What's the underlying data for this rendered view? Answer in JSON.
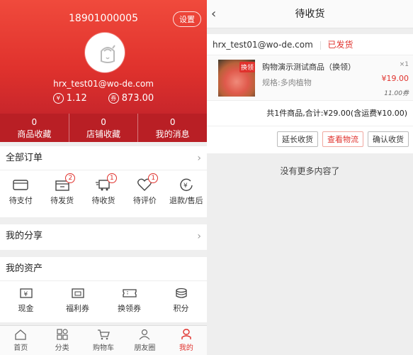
{
  "profile": {
    "phone": "18901000005",
    "settings_label": "设置",
    "email": "hrx_test01@wo-de.com",
    "cash_symbol": "¥",
    "cash_balance": "1.12",
    "coupon_symbol": "券",
    "coupon_balance": "873.00"
  },
  "stats": [
    {
      "count": "0",
      "label": "商品收藏"
    },
    {
      "count": "0",
      "label": "店铺收藏"
    },
    {
      "count": "0",
      "label": "我的消息"
    }
  ],
  "orders_section": {
    "title": "全部订单",
    "chevron": "›",
    "items": [
      {
        "label": "待支付",
        "icon": "wallet-icon",
        "badge": ""
      },
      {
        "label": "待发货",
        "icon": "box-icon",
        "badge": "2"
      },
      {
        "label": "待收货",
        "icon": "truck-icon",
        "badge": "1"
      },
      {
        "label": "待评价",
        "icon": "heart-icon",
        "badge": "1"
      },
      {
        "label": "退款/售后",
        "icon": "refund-icon",
        "badge": ""
      }
    ]
  },
  "share_section": {
    "title": "我的分享",
    "chevron": "›"
  },
  "assets_section": {
    "title": "我的资产",
    "items": [
      {
        "label": "现金",
        "icon": "cash-icon"
      },
      {
        "label": "福利券",
        "icon": "voucher-icon"
      },
      {
        "label": "换领券",
        "icon": "ticket-icon"
      },
      {
        "label": "积分",
        "icon": "points-icon"
      }
    ]
  },
  "tabbar": [
    {
      "label": "首页",
      "icon": "home-icon",
      "active": false
    },
    {
      "label": "分类",
      "icon": "category-icon",
      "active": false
    },
    {
      "label": "购物车",
      "icon": "cart-icon",
      "active": false
    },
    {
      "label": "朋友圈",
      "icon": "friends-icon",
      "active": false
    },
    {
      "label": "我的",
      "icon": "user-icon",
      "active": true
    }
  ],
  "order_page": {
    "back": "‹",
    "title": "待收货",
    "shop_email": "hrx_test01@wo-de.com",
    "status": "已发货",
    "goods": {
      "tag": "换领",
      "name": "购物演示测试商品（换领）",
      "qty": "×1",
      "spec": "规格:多肉植物",
      "price": "¥19.00",
      "coupon": "11.00券"
    },
    "summary": "共1件商品,合计:¥29.00(含运费¥10.00)",
    "actions": [
      "延长收货",
      "查看物流",
      "确认收货"
    ],
    "no_more": "没有更多内容了"
  },
  "colors": {
    "accent": "#e0322d",
    "header_dark": "#b91f25"
  }
}
